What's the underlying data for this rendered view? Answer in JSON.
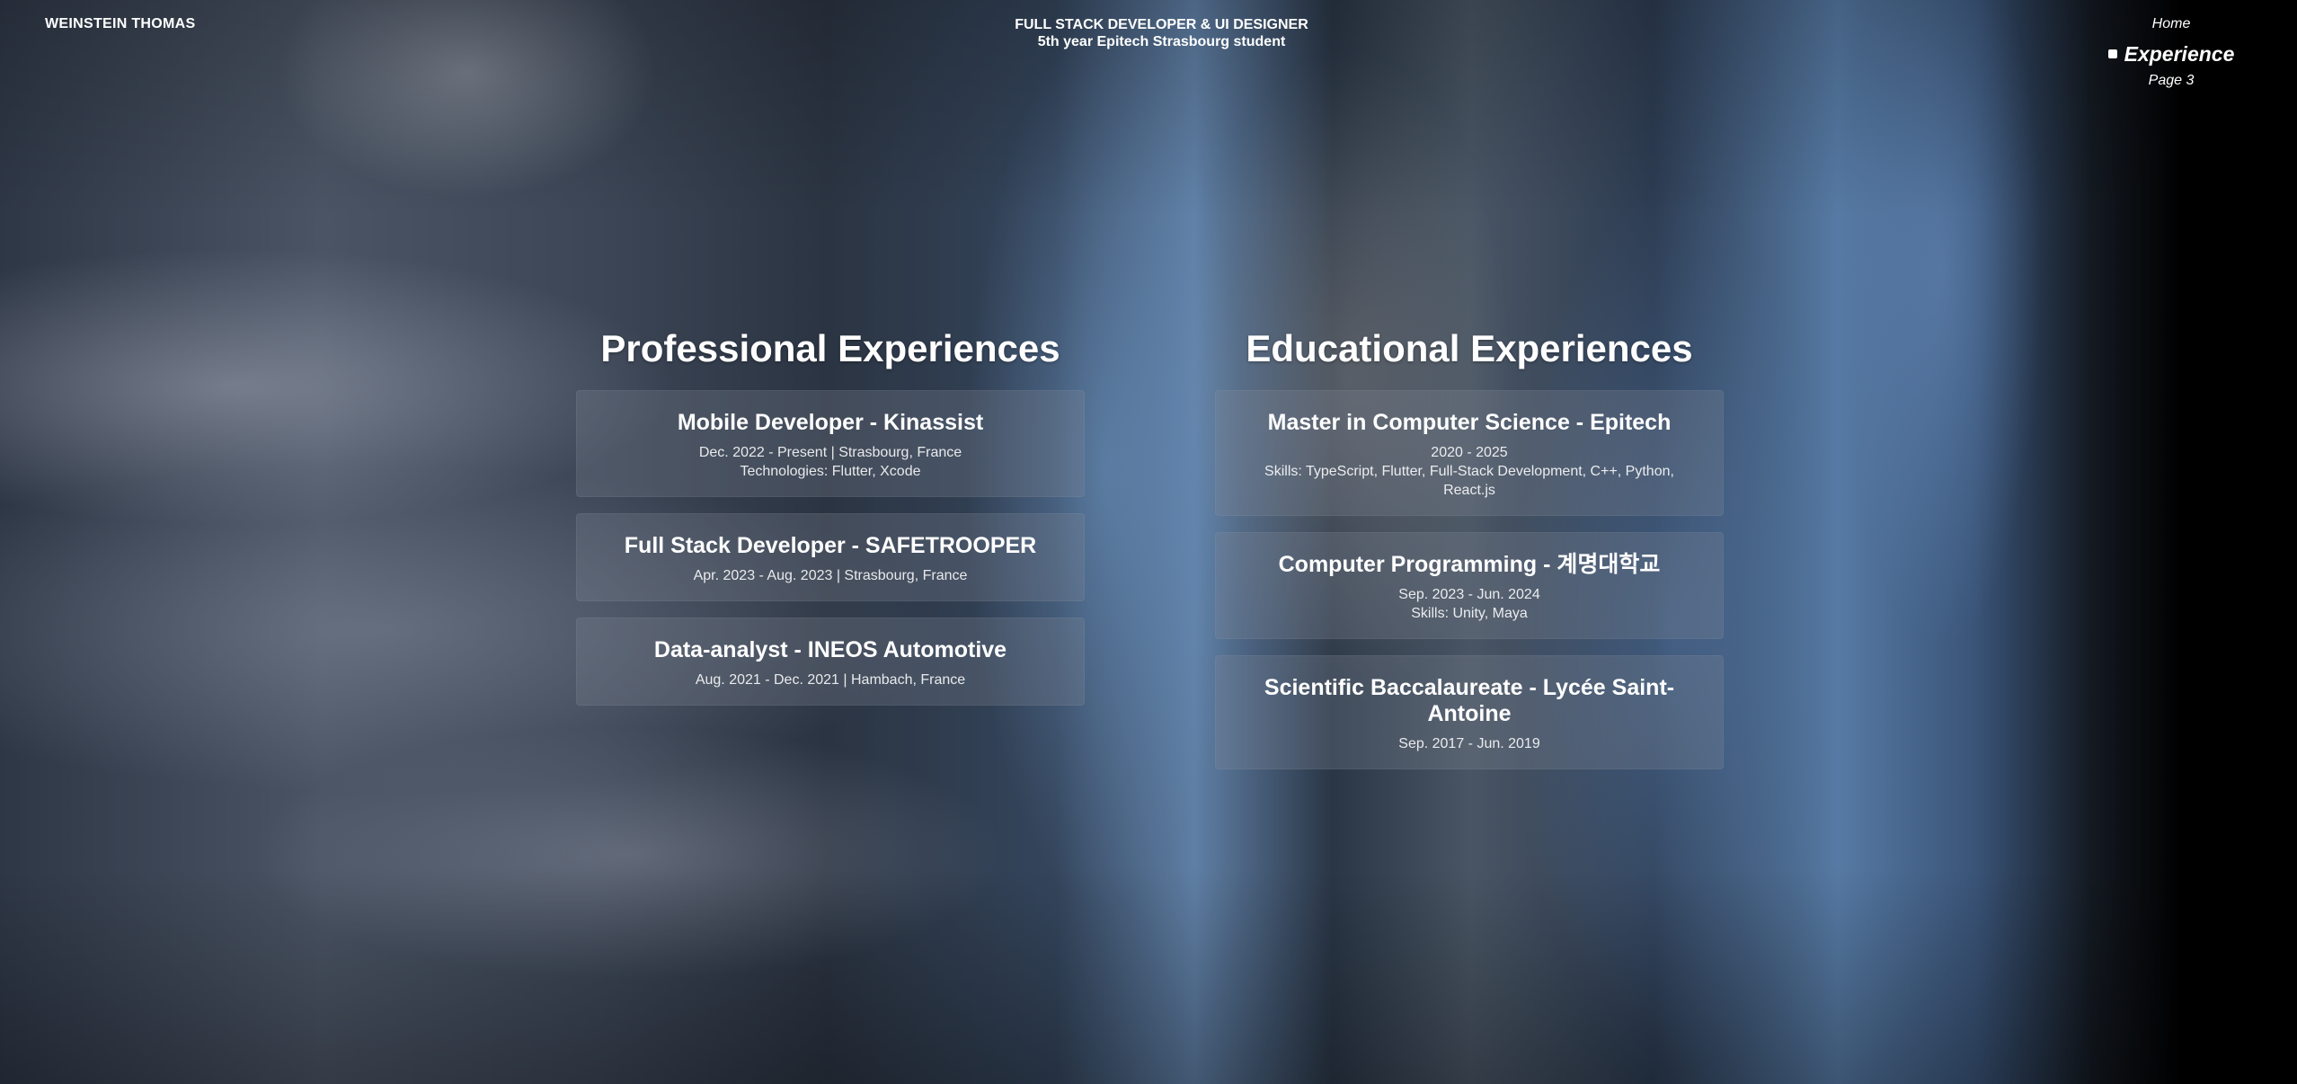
{
  "header": {
    "brand": "WEINSTEIN THOMAS",
    "tagline_line1": "FULL STACK DEVELOPER & UI DESIGNER",
    "tagline_line2": "5th year Epitech Strasbourg student"
  },
  "nav": {
    "items": [
      {
        "label": "Home",
        "active": false
      },
      {
        "label": "Experience",
        "active": true
      },
      {
        "label": "Page 3",
        "active": false
      }
    ]
  },
  "professional": {
    "title": "Professional Experiences",
    "cards": [
      {
        "title": "Mobile Developer - Kinassist",
        "line1": "Dec. 2022 - Present | Strasbourg, France",
        "line2": "Technologies: Flutter, Xcode"
      },
      {
        "title": "Full Stack Developer - SAFETROOPER",
        "line1": "Apr. 2023 - Aug. 2023 | Strasbourg, France"
      },
      {
        "title": "Data-analyst - INEOS Automotive",
        "line1": "Aug. 2021 - Dec. 2021 | Hambach, France"
      }
    ]
  },
  "educational": {
    "title": "Educational Experiences",
    "cards": [
      {
        "title": "Master in Computer Science - Epitech",
        "line1": "2020 - 2025",
        "line2": "Skills: TypeScript, Flutter, Full-Stack Development, C++, Python, React.js"
      },
      {
        "title": "Computer Programming - 계명대학교",
        "line1": "Sep. 2023 - Jun. 2024",
        "line2": "Skills: Unity, Maya"
      },
      {
        "title": "Scientific Baccalaureate - Lycée Saint-Antoine",
        "line1": "Sep. 2017 - Jun. 2019"
      }
    ]
  }
}
